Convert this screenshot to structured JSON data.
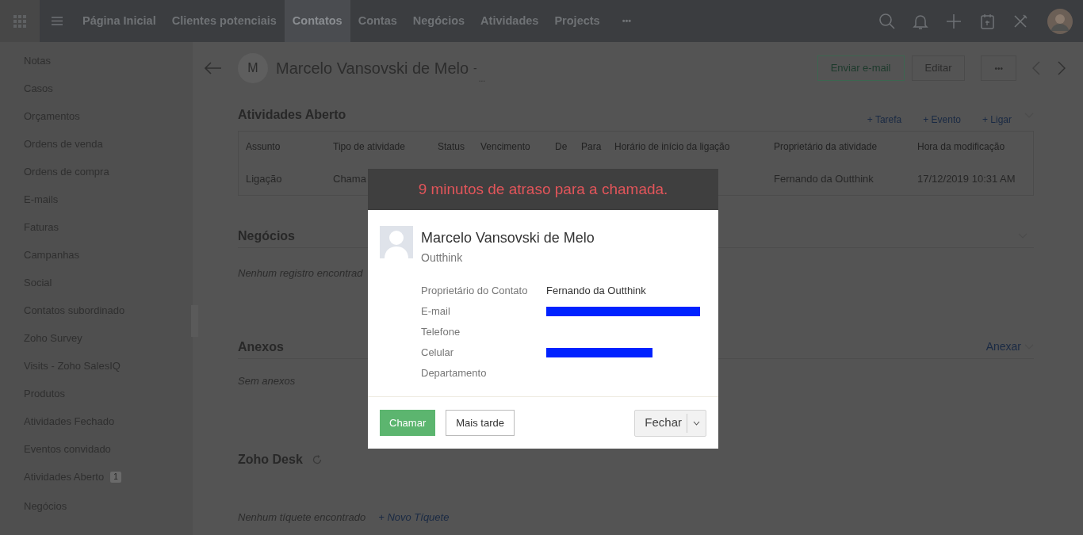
{
  "topbar": {
    "nav": [
      {
        "label": "Página Inicial",
        "selected": false
      },
      {
        "label": "Clientes potenciais",
        "selected": false
      },
      {
        "label": "Contatos",
        "selected": true
      },
      {
        "label": "Contas",
        "selected": false
      },
      {
        "label": "Negócios",
        "selected": false
      },
      {
        "label": "Atividades",
        "selected": false
      },
      {
        "label": "Projects",
        "selected": false
      }
    ],
    "more": "•••"
  },
  "sidebar": {
    "items": [
      {
        "label": "Notas"
      },
      {
        "label": "Casos"
      },
      {
        "label": "Orçamentos"
      },
      {
        "label": "Ordens de venda"
      },
      {
        "label": "Ordens de compra"
      },
      {
        "label": "E-mails"
      },
      {
        "label": "Faturas"
      },
      {
        "label": "Campanhas"
      },
      {
        "label": "Social"
      },
      {
        "label": "Contatos subordinado"
      },
      {
        "label": "Zoho Survey"
      },
      {
        "label": "Visits - Zoho SalesIQ"
      },
      {
        "label": "Produtos"
      },
      {
        "label": "Atividades Fechado"
      },
      {
        "label": "Eventos convidado"
      },
      {
        "label": "Atividades Aberto",
        "count": "1"
      },
      {
        "label": "Negócios"
      }
    ]
  },
  "record": {
    "avatar_letter": "M",
    "name": "Marcelo Vansovski de Melo",
    "suffix": "-",
    "more": "...",
    "buttons": [
      {
        "label": "Enviar e-mail",
        "kind": "primary"
      },
      {
        "label": "Editar",
        "kind": "default"
      },
      {
        "label": "•••",
        "kind": "default"
      }
    ],
    "prev_disabled": true
  },
  "activities": {
    "title": "Atividades Aberto",
    "actions": [
      "+ Tarefa",
      "+ Evento",
      "+ Ligar"
    ],
    "table": {
      "columns": [
        "Assunto",
        "Tipo de atividade",
        "Status",
        "Vencimento",
        "De",
        "Para",
        "Horário de início da ligação",
        "Proprietário da atividade",
        "Hora da modificação"
      ],
      "rows": [
        [
          "Ligação",
          "Chama",
          "",
          "",
          "",
          "",
          "",
          "Fernando da Outthink",
          "17/12/2019 10:31 AM"
        ]
      ]
    }
  },
  "deals": {
    "title": "Negócios",
    "empty": "Nenhum registro encontrad"
  },
  "attachments": {
    "title": "Anexos",
    "empty": "Sem anexos",
    "action": "Anexar"
  },
  "desk": {
    "title": "Zoho Desk",
    "empty": "Nenhum tíquete encontrado",
    "action": "+ Novo Tíquete"
  },
  "dialog": {
    "title": "9 minutos de atraso para a chamada.",
    "name": "Marcelo Vansovski de Melo",
    "company": "Outthink",
    "fields": [
      {
        "label": "Proprietário do Contato",
        "value": "Fernando da Outthink",
        "redacted": false
      },
      {
        "label": "E-mail",
        "redacted": true,
        "kind": "email"
      },
      {
        "label": "Telefone",
        "redacted": false
      },
      {
        "label": "Celular",
        "redacted": true,
        "kind": "phone"
      },
      {
        "label": "Departamento",
        "redacted": false
      }
    ],
    "buttons": [
      {
        "label": "Chamar",
        "kind": "success"
      },
      {
        "label": "Mais tarde",
        "kind": "outline"
      },
      {
        "label": "Fechar",
        "kind": "split"
      }
    ]
  }
}
